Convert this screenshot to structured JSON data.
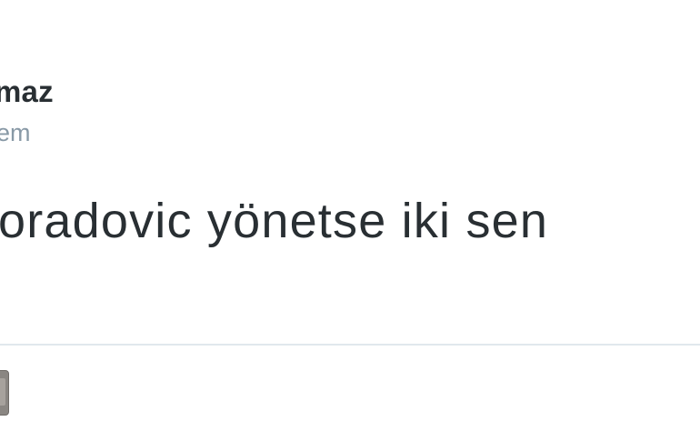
{
  "tweet": {
    "display_name": "maz",
    "handle": "em",
    "text": "oradovic yönetse iki sen",
    "media_icon": "image-thumbnail-icon"
  }
}
